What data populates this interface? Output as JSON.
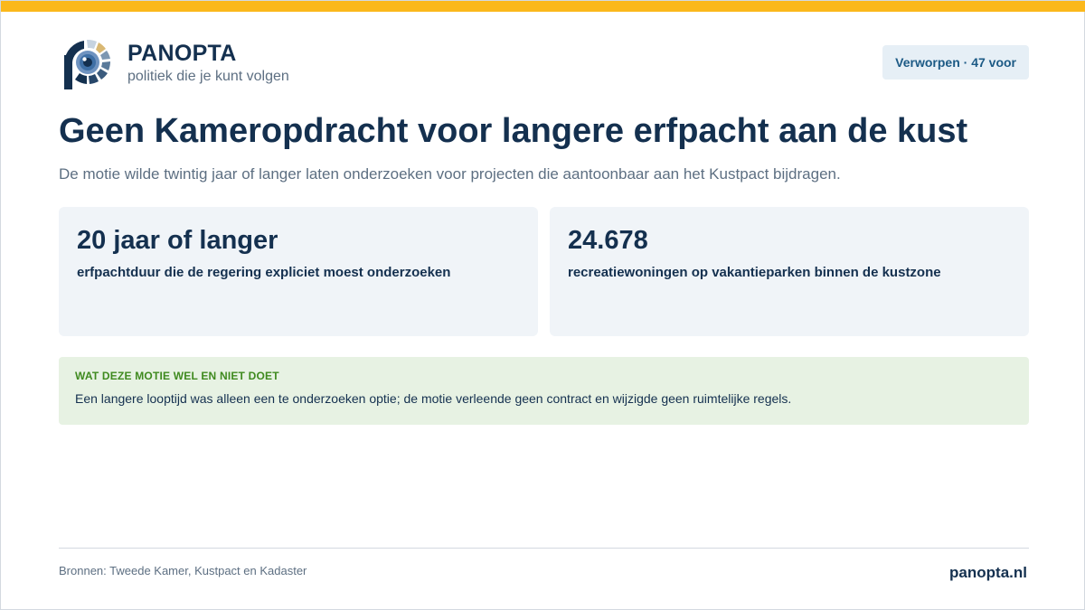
{
  "brand": {
    "name": "PANOPTA",
    "tagline": "politiek die je kunt volgen",
    "logo_icon": "panopta-eye-logo-icon"
  },
  "status_badge": "Verworpen · 47 voor",
  "title": "Geen Kameropdracht voor langere erfpacht aan de kust",
  "subtitle": "De motie wilde twintig jaar of langer laten onderzoeken voor projecten die aantoonbaar aan het Kustpact bijdragen.",
  "stats": [
    {
      "value": "20 jaar of langer",
      "label": "erfpachtduur die de regering expliciet moest onderzoeken"
    },
    {
      "value": "24.678",
      "label": "recreatiewoningen op vakantieparken binnen de kustzone"
    }
  ],
  "note": {
    "heading": "Wat deze motie wel en niet doet",
    "text": "Een langere looptijd was alleen een te onderzoeken optie; de motie verleende geen contract en wijzigde geen ruimtelijke regels."
  },
  "footer": {
    "sources": "Bronnen: Tweede Kamer, Kustpact en Kadaster",
    "site": "panopta.nl"
  },
  "colors": {
    "accent_bar": "#fbb81b",
    "primary_text": "#14304f",
    "muted_text": "#5d6f82",
    "card_bg": "#f0f4f8",
    "badge_bg": "#e6eff6",
    "badge_text": "#1c5a85",
    "note_bg": "#e7f2e3",
    "note_heading": "#3f8a1f"
  }
}
